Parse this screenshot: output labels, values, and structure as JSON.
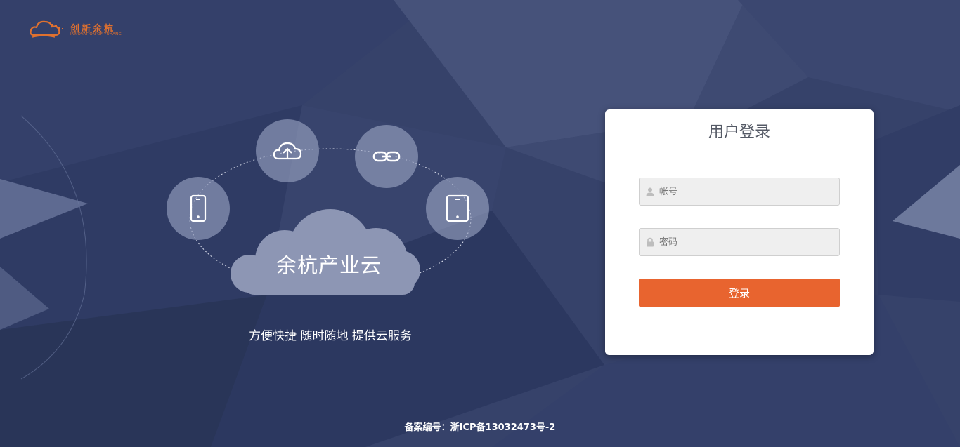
{
  "logo": {
    "title": "创新余杭",
    "subtitle": "INNOVATION OF YUHANG",
    "brand_color": "#e0712f"
  },
  "hero": {
    "cloud_label": "余杭产业云",
    "slogan": "方便快捷 随时随地 提供云服务",
    "icons": [
      "phone-icon",
      "cloud-upload-icon",
      "link-icon",
      "tablet-icon"
    ]
  },
  "login": {
    "title": "用户登录",
    "username_placeholder": "帐号",
    "password_placeholder": "密码",
    "submit_label": "登录",
    "accent_color": "#e8642f"
  },
  "footer": {
    "text": "备案编号：浙ICP备13032473号-2"
  }
}
